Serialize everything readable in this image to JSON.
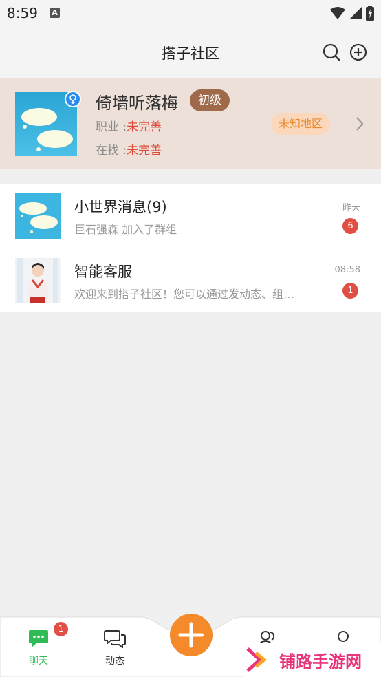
{
  "status_bar": {
    "time": "8:59",
    "notification_letter": "A"
  },
  "header": {
    "title": "搭子社区",
    "icons": [
      "search-icon",
      "add-circle-icon"
    ]
  },
  "profile": {
    "name": "倚墙听落梅",
    "level": "初级",
    "job_label": "职业 :",
    "job_value": "未完善",
    "seeking_label": "在找 :",
    "seeking_value": "未完善",
    "region": "未知地区",
    "gender_icon": "female-icon"
  },
  "chats": [
    {
      "name": "小世界消息(9)",
      "preview": "巨石强森 加入了群组",
      "time": "昨天",
      "unread": "6"
    },
    {
      "name": "智能客服",
      "preview": "欢迎来到搭子社区！您可以通过发动态、组…",
      "time": "08:58",
      "unread": "1"
    }
  ],
  "tabs": [
    {
      "label": "聊天",
      "icon": "chat-bubble-icon",
      "badge": "1",
      "active": true
    },
    {
      "label": "动态",
      "icon": "moments-icon",
      "active": false
    }
  ],
  "watermark": {
    "text": "铺路手游网"
  },
  "colors": {
    "accent_green": "#2fbb55",
    "accent_orange": "#f58a2a",
    "badge_red": "#e04e44",
    "profile_bg": "#ede0d9",
    "level_brown": "#9e6a4a"
  }
}
